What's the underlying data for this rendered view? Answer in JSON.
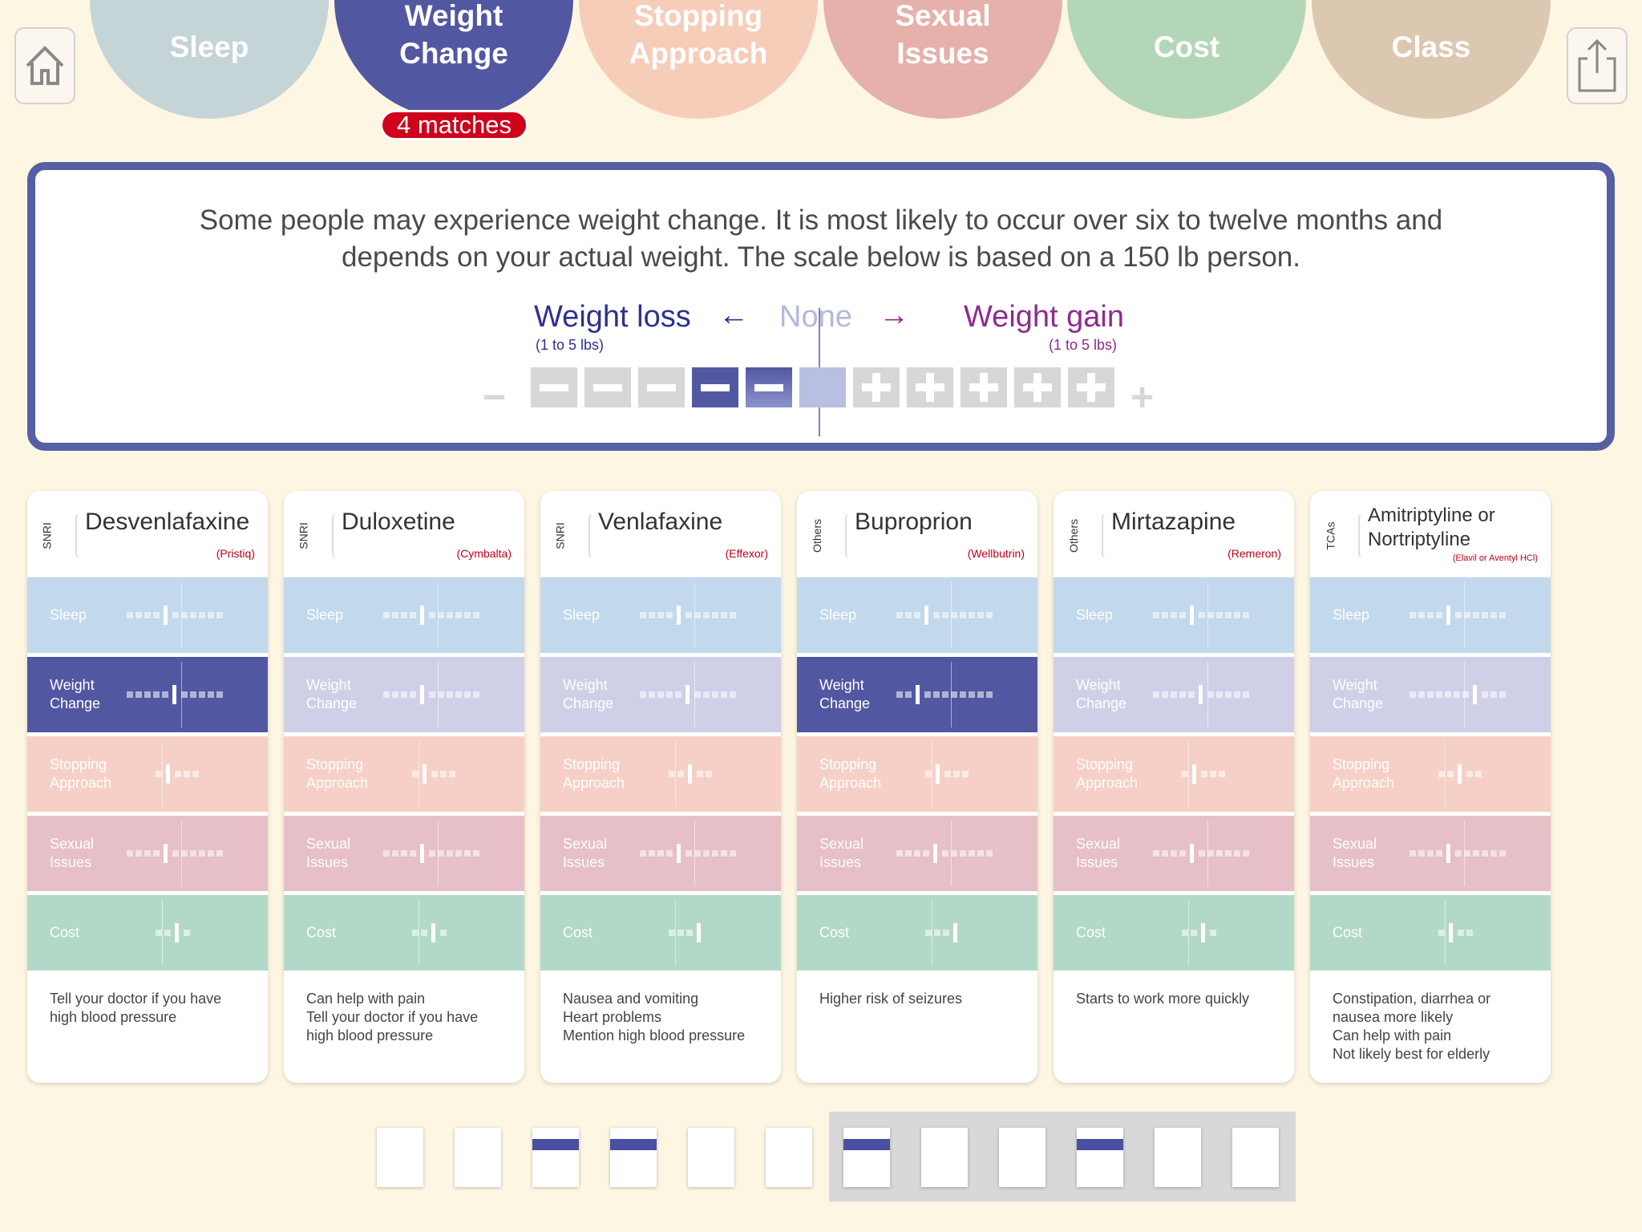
{
  "tabs": [
    {
      "line1": "Sleep",
      "line2": "",
      "color": "#c4d4d7"
    },
    {
      "line1": "Weight",
      "line2": "Change",
      "color": "#5257a2",
      "active": true
    },
    {
      "line1": "Stopping",
      "line2": "Approach",
      "color": "#f6cdb9"
    },
    {
      "line1": "Sexual",
      "line2": "Issues",
      "color": "#e5b1aa"
    },
    {
      "line1": "Cost",
      "line2": "",
      "color": "#b4d6b8"
    },
    {
      "line1": "Class",
      "line2": "",
      "color": "#dcc8b1"
    }
  ],
  "badge": "4 matches",
  "icons": {
    "home": "home-icon",
    "share": "share-icon"
  },
  "info": {
    "text": "Some people may experience weight change. It is most likely to occur over six to twelve months and depends on your actual weight. The scale below is based on a 150 lb person.",
    "loss_label": "Weight loss",
    "loss_sub": "(1 to 5 lbs)",
    "none_label": "None",
    "gain_label": "Weight gain",
    "gain_sub": "(1 to 5 lbs)",
    "left_arrow": "←",
    "right_arrow": "→",
    "minus_end": "−",
    "plus_end": "+"
  },
  "row_labels": {
    "sleep": [
      "Sleep",
      ""
    ],
    "weight": [
      "Weight",
      "Change"
    ],
    "stopping": [
      "Stopping",
      "Approach"
    ],
    "sexual": [
      "Sexual",
      "Issues"
    ],
    "cost": [
      "Cost",
      ""
    ]
  },
  "cards": [
    {
      "class": "SNRI",
      "name": "Desvenlafaxine",
      "brand": "(Pristiq)",
      "weight_active": true,
      "note": [
        "Tell your doctor if you have",
        "high blood pressure"
      ]
    },
    {
      "class": "SNRI",
      "name": "Duloxetine",
      "brand": "(Cymbalta)",
      "weight_active": false,
      "note": [
        "Can help with pain",
        "Tell your doctor if you have",
        "high blood pressure"
      ]
    },
    {
      "class": "SNRI",
      "name": "Venlafaxine",
      "brand": "(Effexor)",
      "weight_active": false,
      "note": [
        "Nausea and vomiting",
        "Heart problems",
        "Mention high blood pressure"
      ]
    },
    {
      "class": "Others",
      "name": "Buproprion",
      "brand": "(Wellbutrin)",
      "weight_active": true,
      "note": [
        "Higher risk of seizures"
      ]
    },
    {
      "class": "Others",
      "name": "Mirtazapine",
      "brand": "(Remeron)",
      "weight_active": false,
      "note": [
        "Starts to work more quickly"
      ]
    },
    {
      "class": "TCAs",
      "name": "Amitriptyline or Nortriptyline",
      "brand": "(Elavil or Aventyl HCl)",
      "weight_active": false,
      "note": [
        "Constipation, diarrhea or",
        "nausea more likely",
        "Can help with pain",
        "Not likely best for elderly"
      ]
    }
  ],
  "colors": {
    "sleep": "#c2d8ec",
    "weight": "#cfd0e8",
    "weight_active": "#5257a2",
    "stopping": "#f6d0c6",
    "sexual": "#e7bfc6",
    "cost": "#b2d9c8",
    "accent": "#5560a4",
    "badge": "#d0021b"
  },
  "selector_slots": [
    false,
    false,
    true,
    true,
    false,
    false,
    true,
    false,
    false,
    true,
    false,
    false
  ]
}
